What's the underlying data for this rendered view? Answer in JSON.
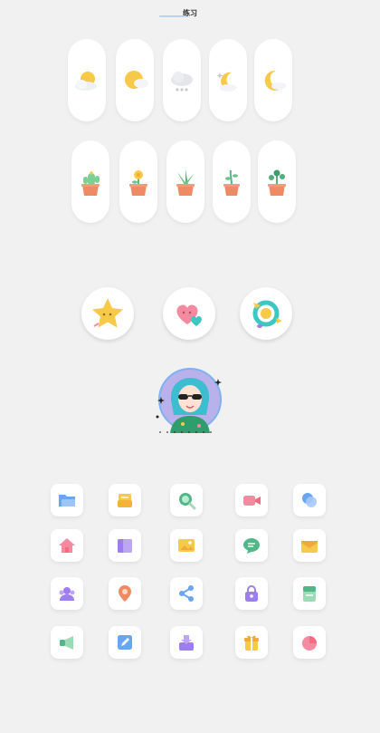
{
  "page": {
    "title": "练习"
  },
  "weather_icons": [
    "partly-sunny-icon",
    "sun-cloud-icon",
    "rain-cloud-icon",
    "crescent-moon-stars-icon",
    "moon-cloud-icon"
  ],
  "plant_icons": [
    "cactus-pot-icon",
    "flower-pot-icon",
    "aloe-pot-icon",
    "sprout-pot-icon",
    "round-leaf-pot-icon"
  ],
  "round_icons": [
    "star-icon",
    "hearts-icon",
    "flower-ring-icon"
  ],
  "avatar": {
    "icon": "girl-sunglasses-avatar"
  },
  "app_icons": [
    "folder-icon",
    "inbox-tray-icon",
    "search-icon",
    "video-camera-icon",
    "bubbles-icon",
    "home-icon",
    "book-icon",
    "image-icon",
    "chat-icon",
    "envelope-icon",
    "user-group-icon",
    "location-pin-icon",
    "share-icon",
    "lock-icon",
    "notebook-icon",
    "megaphone-icon",
    "edit-icon",
    "download-tray-icon",
    "gift-icon",
    "pie-chart-icon"
  ],
  "colors": {
    "background": "#f1f1f1",
    "yellow": "#f7c948",
    "pot": "#ee8a64",
    "green": "#52b788",
    "blue": "#6aa5f0",
    "pink": "#f48aa0",
    "purple": "#9d7df0",
    "teal": "#3dc7c2"
  }
}
